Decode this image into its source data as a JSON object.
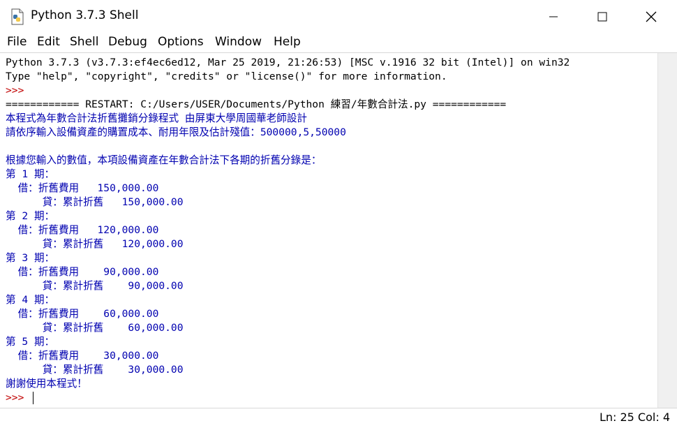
{
  "window": {
    "title": "Python 3.7.3 Shell",
    "buttons": {
      "minimize": "minimize",
      "maximize": "maximize",
      "close": "close"
    }
  },
  "menu": [
    "File",
    "Edit",
    "Shell",
    "Debug",
    "Options",
    "Window",
    "Help"
  ],
  "shell": {
    "lines": [
      {
        "text": "Python 3.7.3 (v3.7.3:ef4ec6ed12, Mar 25 2019, 21:26:53) [MSC v.1916 32 bit (Intel)] on win32",
        "color": "black"
      },
      {
        "text": "Type \"help\", \"copyright\", \"credits\" or \"license()\" for more information.",
        "color": "black"
      },
      {
        "text": ">>> ",
        "color": "red"
      },
      {
        "text": "============ RESTART: C:/Users/USER/Documents/Python 練習/年數合計法.py ============",
        "color": "black"
      },
      {
        "text": "本程式為年數合計法折舊攤銷分錄程式 由屏東大學周國華老師設計",
        "color": "blue"
      },
      {
        "text": "請依序輸入設備資產的購置成本、耐用年限及估計殘值：500000,5,50000",
        "color": "blue"
      },
      {
        "text": "",
        "color": "blue"
      },
      {
        "text": "根據您輸入的數值，本項設備資產在年數合計法下各期的折舊分錄是：",
        "color": "blue"
      },
      {
        "text": "第 1 期：",
        "color": "blue"
      },
      {
        "text": "  借：折舊費用   150,000.00",
        "color": "blue"
      },
      {
        "text": "      貸：累計折舊   150,000.00",
        "color": "blue"
      },
      {
        "text": "第 2 期：",
        "color": "blue"
      },
      {
        "text": "  借：折舊費用   120,000.00",
        "color": "blue"
      },
      {
        "text": "      貸：累計折舊   120,000.00",
        "color": "blue"
      },
      {
        "text": "第 3 期：",
        "color": "blue"
      },
      {
        "text": "  借：折舊費用    90,000.00",
        "color": "blue"
      },
      {
        "text": "      貸：累計折舊    90,000.00",
        "color": "blue"
      },
      {
        "text": "第 4 期：",
        "color": "blue"
      },
      {
        "text": "  借：折舊費用    60,000.00",
        "color": "blue"
      },
      {
        "text": "      貸：累計折舊    60,000.00",
        "color": "blue"
      },
      {
        "text": "第 5 期：",
        "color": "blue"
      },
      {
        "text": "  借：折舊費用    30,000.00",
        "color": "blue"
      },
      {
        "text": "      貸：累計折舊    30,000.00",
        "color": "blue"
      },
      {
        "text": "謝謝使用本程式！",
        "color": "blue"
      }
    ],
    "prompt": ">>> "
  },
  "status": {
    "text": "Ln: 25  Col: 4"
  },
  "colors": {
    "prompt": "#c00000",
    "output": "#0000b0",
    "text": "#000000"
  },
  "icons": {
    "app": "python-file-icon"
  }
}
